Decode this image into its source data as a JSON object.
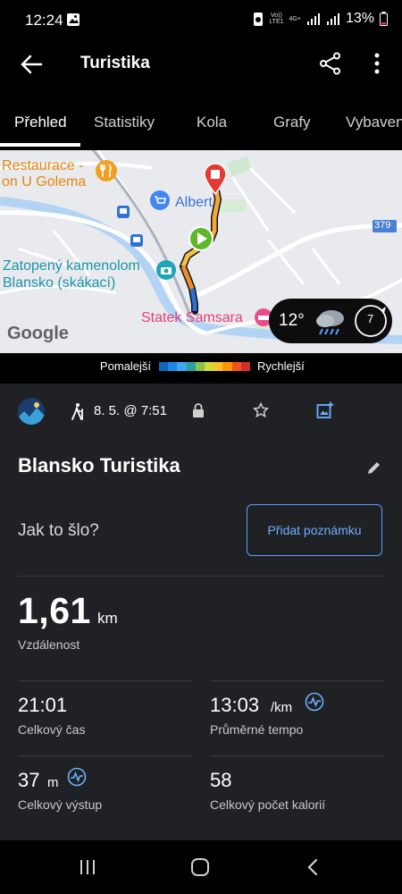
{
  "status_bar": {
    "time": "12:24",
    "volte_top": "Vo))",
    "volte_bottom": "LTE1",
    "network": "4G+",
    "battery": "13%"
  },
  "app_bar": {
    "title": "Turistika"
  },
  "tabs": [
    {
      "label": "Přehled",
      "active": true
    },
    {
      "label": "Statistiky",
      "active": false
    },
    {
      "label": "Kola",
      "active": false
    },
    {
      "label": "Grafy",
      "active": false
    },
    {
      "label": "Vybavení",
      "active": false
    }
  ],
  "map": {
    "labels": {
      "restaurant_line1": "Restaurace -",
      "restaurant_line2": "on U Golema",
      "albert": "Albert",
      "road_number": "379",
      "quarry_line1": "Zatopený kamenolom",
      "quarry_line2": "Blansko (skákací)",
      "statek": "Statek Samsara",
      "google": "Google"
    },
    "weather": {
      "temperature": "12°",
      "wind": "7"
    }
  },
  "speed_legend": {
    "slower": "Pomalejší",
    "faster": "Rychlejší",
    "colors": [
      "#1565c0",
      "#1e88e5",
      "#42a5f5",
      "#26a69a",
      "#8bc34a",
      "#cddc39",
      "#fbc02d",
      "#ff9800",
      "#f4511e",
      "#d32f2f"
    ]
  },
  "activity": {
    "date_time": "8. 5. @ 7:51",
    "title": "Blansko Turistika",
    "how_it_went": "Jak to šlo?",
    "add_note": "Přidat poznámku"
  },
  "stats": {
    "distance": {
      "value": "1,61",
      "unit": "km",
      "label": "Vzdálenost"
    },
    "total_time": {
      "value": "21:01",
      "label": "Celkový čas"
    },
    "avg_pace": {
      "value": "13:03",
      "unit": "/km",
      "label": "Průměrné tempo"
    },
    "ascent": {
      "value": "37",
      "unit": "m",
      "label": "Celkový výstup"
    },
    "calories": {
      "value": "58",
      "label": "Celkový počet kalorií"
    }
  },
  "colors": {
    "background": "#202124",
    "accent_blue": "#6cb0ff",
    "start_marker": "#5bb82a",
    "end_marker": "#e53935"
  }
}
